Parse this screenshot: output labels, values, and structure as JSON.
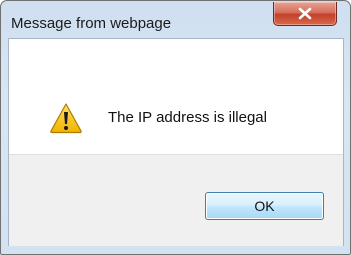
{
  "dialog": {
    "title": "Message from webpage",
    "message": "The IP address is illegal",
    "ok_label": "OK",
    "icons": {
      "alert": "warning-icon",
      "close": "close-icon"
    },
    "colors": {
      "frame": "#d3e2f1",
      "close_button": "#c2402a",
      "ok_button": "#bee6fd",
      "footer": "#f0f0f0"
    }
  }
}
